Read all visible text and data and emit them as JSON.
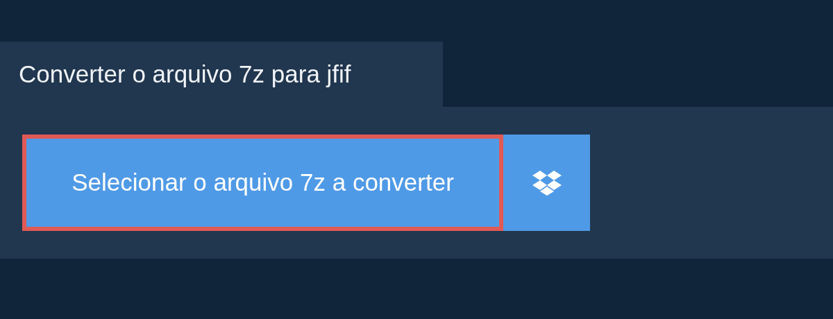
{
  "tab": {
    "title": "Converter o arquivo 7z para jfif"
  },
  "select_button": {
    "label": "Selecionar o arquivo 7z a converter",
    "highlighted": true
  }
}
